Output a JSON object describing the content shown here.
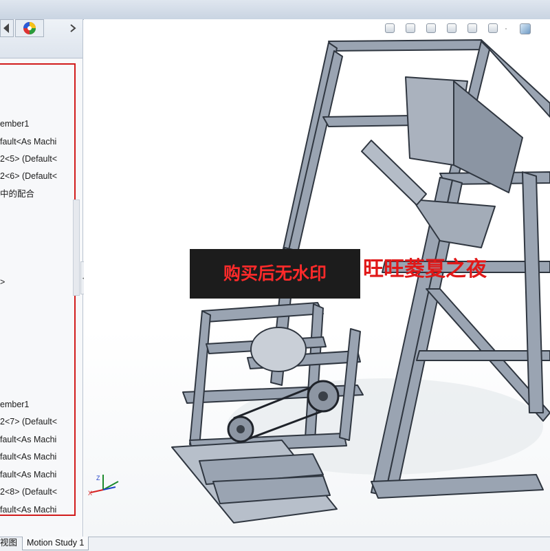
{
  "tree": {
    "items": [
      {
        "label": "ember1"
      },
      {
        "label": "fault<As Machi"
      },
      {
        "label": "2<5> (Default<"
      },
      {
        "label": "2<6> (Default<"
      },
      {
        "label": "中的配合"
      },
      {
        "label": ">"
      },
      {
        "label": "ember1"
      },
      {
        "label": "2<7> (Default<"
      },
      {
        "label": "fault<As Machi"
      },
      {
        "label": "fault<As Machi"
      },
      {
        "label": "fault<As Machi"
      },
      {
        "label": "2<8> (Default<"
      },
      {
        "label": "fault<As Machi"
      }
    ]
  },
  "bottom": {
    "left_tab": "视图",
    "motion_tab": "Motion Study 1"
  },
  "watermark": {
    "boxed": "购买后无水印",
    "text": "旺旺菱夏之夜"
  },
  "icons": {
    "panel_tabs": [
      "chevron-left-icon",
      "appearance-icon",
      "chevron-right-icon"
    ],
    "view_toolbar": [
      "zoom-icon",
      "zoom-area-icon",
      "previous-view-icon",
      "section-view-icon",
      "view-orientation-icon",
      "display-style-icon",
      "hide-show-icon",
      "edit-appearance-icon"
    ]
  }
}
